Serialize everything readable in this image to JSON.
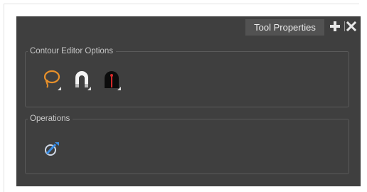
{
  "panel": {
    "tab_label": "Tool Properties",
    "add_icon": "plus-icon",
    "close_icon": "close-icon"
  },
  "contour_editor": {
    "title": "Contour Editor Options",
    "tools": [
      {
        "name": "lasso-icon",
        "color": "#e8902a"
      },
      {
        "name": "magnet-icon",
        "color": "#ffffff"
      },
      {
        "name": "pressure-stroke-icon",
        "color": "#d42b2b"
      }
    ]
  },
  "operations": {
    "title": "Operations",
    "tools": [
      {
        "name": "pen-stroke-tool-icon",
        "color": "#3a8ee6"
      }
    ]
  },
  "colors": {
    "panel_bg": "#3f3f3f",
    "tab_bg": "#525252",
    "group_border": "#5a5a5a"
  }
}
